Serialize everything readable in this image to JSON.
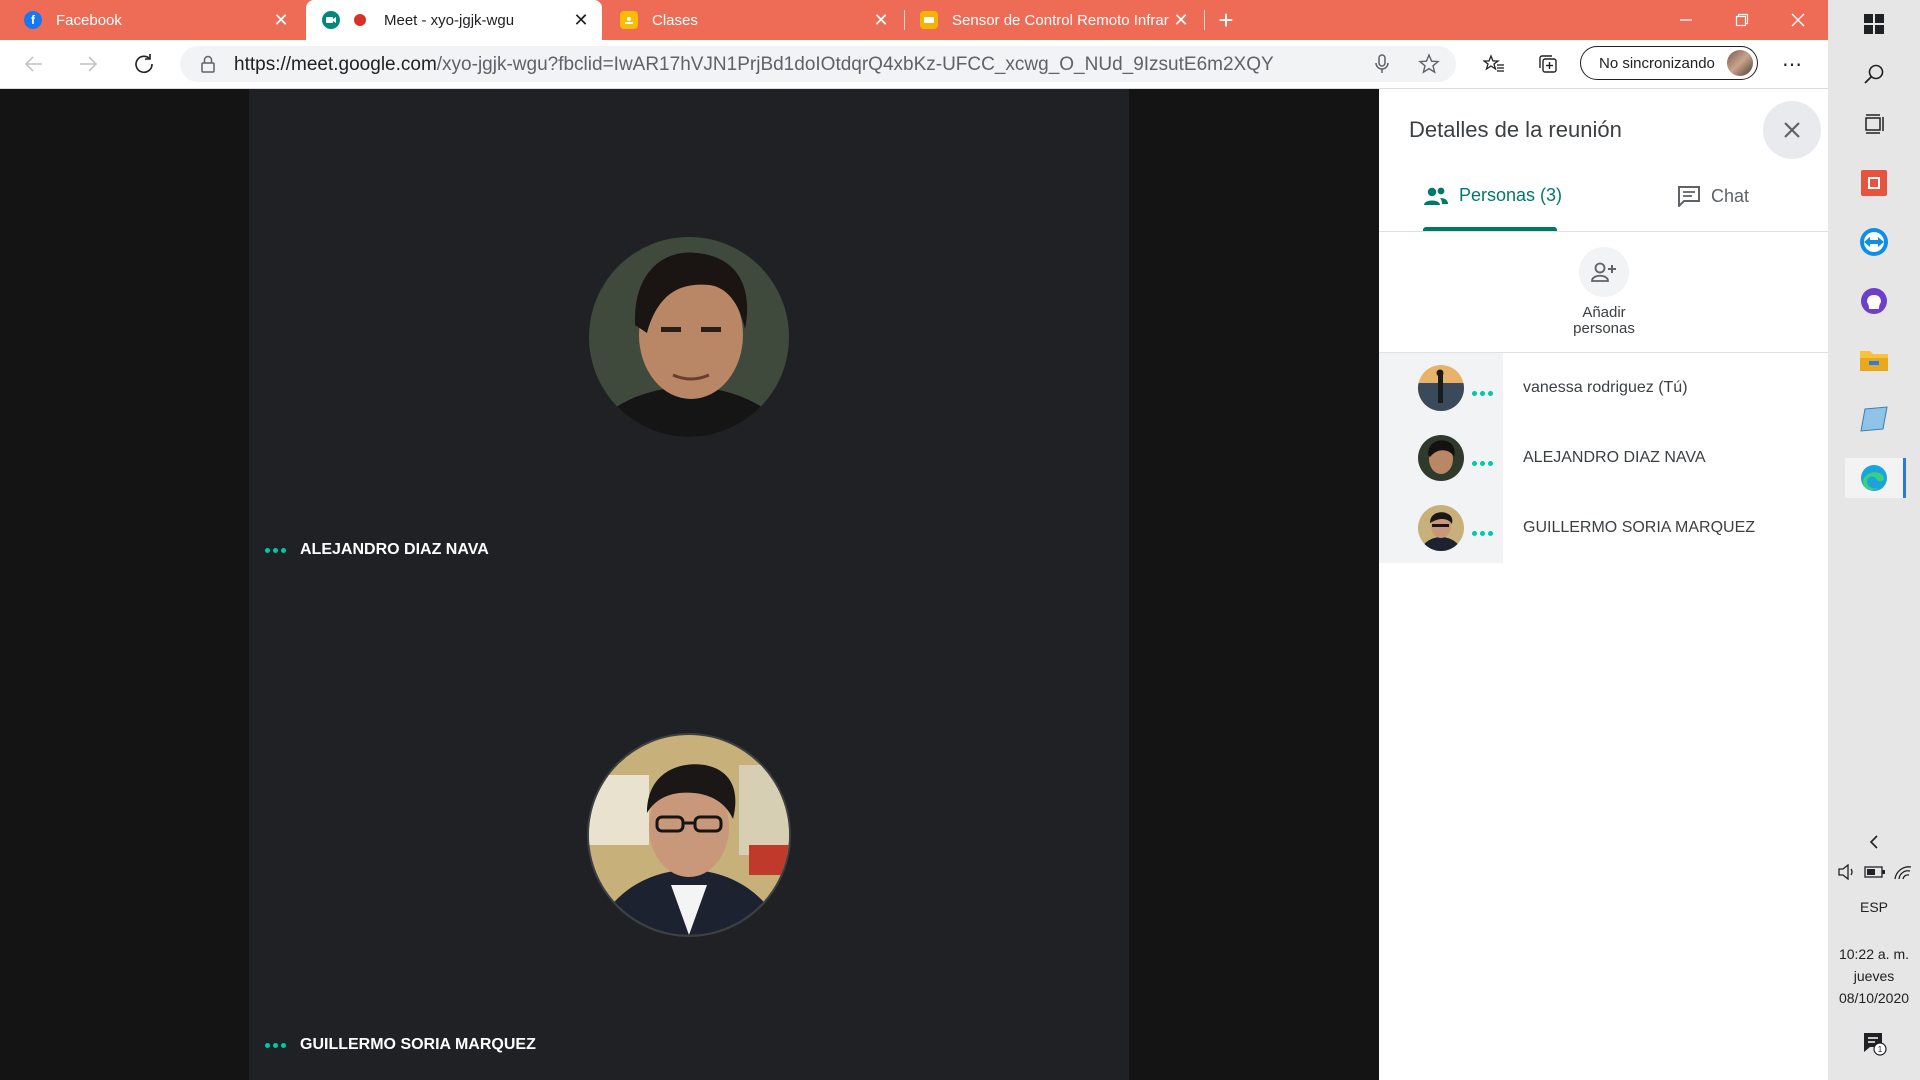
{
  "browser": {
    "tabs": [
      {
        "title": "Facebook",
        "icon": "facebook-icon",
        "color": "#1877f2"
      },
      {
        "title": "Meet - xyo-jgjk-wgu",
        "icon": "meet-icon",
        "color": "#00897b",
        "recording": true
      },
      {
        "title": "Clases",
        "icon": "classroom-icon",
        "color": "#fbbc04"
      },
      {
        "title": "Sensor de Control Remoto Infrar",
        "icon": "slides-icon",
        "color": "#f4b400"
      }
    ],
    "url_host": "https://meet.google.com",
    "url_path": "/xyo-jgjk-wgu?fbclid=IwAR17hVJN1PrjBd1doIOtdqrQ4xbKz-UFCC_xcwg_O_NUd_9IzsutE6m2XQY",
    "profile_label": "No sincronizando",
    "accent": "#ee6b55"
  },
  "stage": {
    "tiles": [
      {
        "name": "ALEJANDRO DIAZ NAVA"
      },
      {
        "name": "GUILLERMO SORIA MARQUEZ"
      }
    ],
    "speaking_color": "#00c9a7"
  },
  "panel": {
    "title": "Detalles de la reunión",
    "tab_people": "Personas (3)",
    "tab_chat": "Chat",
    "add_people_line1": "Añadir",
    "add_people_line2": "personas",
    "people": [
      {
        "name": "vanessa rodriguez (Tú)"
      },
      {
        "name": "ALEJANDRO DIAZ NAVA"
      },
      {
        "name": "GUILLERMO SORIA MARQUEZ"
      }
    ],
    "accent": "#00796b"
  },
  "taskbar": {
    "language": "ESP",
    "time": "10:22 a. m.",
    "day": "jueves",
    "date": "08/10/2020",
    "notifications": "1"
  }
}
